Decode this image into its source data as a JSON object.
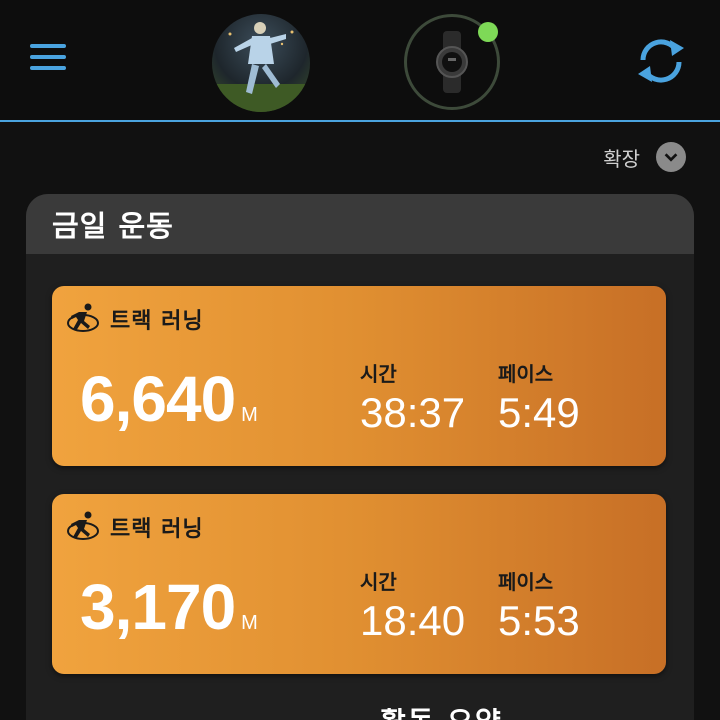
{
  "header": {
    "menu_icon": "hamburger-menu-icon",
    "avatar_icon": "profile-photo",
    "device_icon": "smartwatch-icon",
    "device_status_color": "#7ed957",
    "sync_icon": "sync-icon",
    "accent_color": "#4aa3df"
  },
  "expand": {
    "label": "확장",
    "icon": "chevron-down-icon"
  },
  "section": {
    "title": "금일 운동",
    "activities": [
      {
        "icon": "track-running-icon",
        "name": "트랙 러닝",
        "distance": "6,640",
        "unit": "M",
        "time_label": "시간",
        "time": "38:37",
        "pace_label": "페이스",
        "pace": "5:49"
      },
      {
        "icon": "track-running-icon",
        "name": "트랙 러닝",
        "distance": "3,170",
        "unit": "M",
        "time_label": "시간",
        "time": "18:40",
        "pace_label": "페이스",
        "pace": "5:53"
      }
    ]
  },
  "partial_heading": "활동 요약"
}
